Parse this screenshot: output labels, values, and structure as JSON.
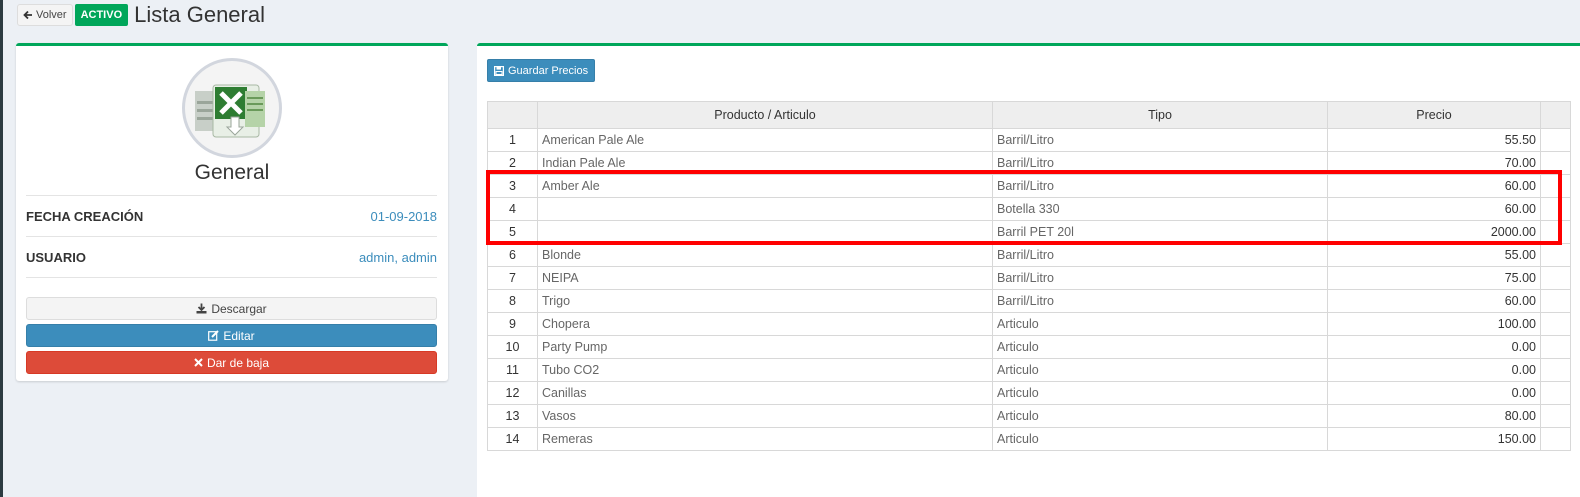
{
  "header": {
    "back_label": "Volver",
    "status_badge": "ACTIVO",
    "title": "Lista General"
  },
  "profile": {
    "name": "General",
    "fields": [
      {
        "label": "FECHA CREACIÓN",
        "value": "01-09-2018"
      },
      {
        "label": "USUARIO",
        "value": "admin, admin"
      }
    ],
    "buttons": {
      "download": "Descargar",
      "edit": "Editar",
      "delete": "Dar de baja"
    }
  },
  "prices": {
    "save_label": "Guardar Precios",
    "columns": [
      "Producto / Articulo",
      "Tipo",
      "Precio"
    ],
    "rows": [
      {
        "n": "1",
        "product": "American Pale Ale",
        "type": "Barril/Litro",
        "price": "55.50"
      },
      {
        "n": "2",
        "product": "Indian Pale Ale",
        "type": "Barril/Litro",
        "price": "70.00"
      },
      {
        "n": "3",
        "product": "Amber Ale",
        "type": "Barril/Litro",
        "price": "60.00"
      },
      {
        "n": "4",
        "product": "",
        "type": "Botella 330",
        "price": "60.00"
      },
      {
        "n": "5",
        "product": "",
        "type": "Barril PET 20l",
        "price": "2000.00"
      },
      {
        "n": "6",
        "product": "Blonde",
        "type": "Barril/Litro",
        "price": "55.00"
      },
      {
        "n": "7",
        "product": "NEIPA",
        "type": "Barril/Litro",
        "price": "75.00"
      },
      {
        "n": "8",
        "product": "Trigo",
        "type": "Barril/Litro",
        "price": "60.00"
      },
      {
        "n": "9",
        "product": "Chopera",
        "type": "Articulo",
        "price": "100.00"
      },
      {
        "n": "10",
        "product": "Party Pump",
        "type": "Articulo",
        "price": "0.00"
      },
      {
        "n": "11",
        "product": "Tubo CO2",
        "type": "Articulo",
        "price": "0.00"
      },
      {
        "n": "12",
        "product": "Canillas",
        "type": "Articulo",
        "price": "0.00"
      },
      {
        "n": "13",
        "product": "Vasos",
        "type": "Articulo",
        "price": "80.00"
      },
      {
        "n": "14",
        "product": "Remeras",
        "type": "Articulo",
        "price": "150.00"
      }
    ]
  },
  "icons": {
    "back": "arrow-left-icon",
    "file": "excel-file-icon",
    "save": "floppy-disk-icon",
    "download": "download-icon",
    "edit": "edit-icon",
    "delete": "close-icon"
  },
  "colors": {
    "success": "#00a65a",
    "primary": "#3c8dbc",
    "danger": "#dd4b39",
    "highlight": "#ff0000"
  }
}
